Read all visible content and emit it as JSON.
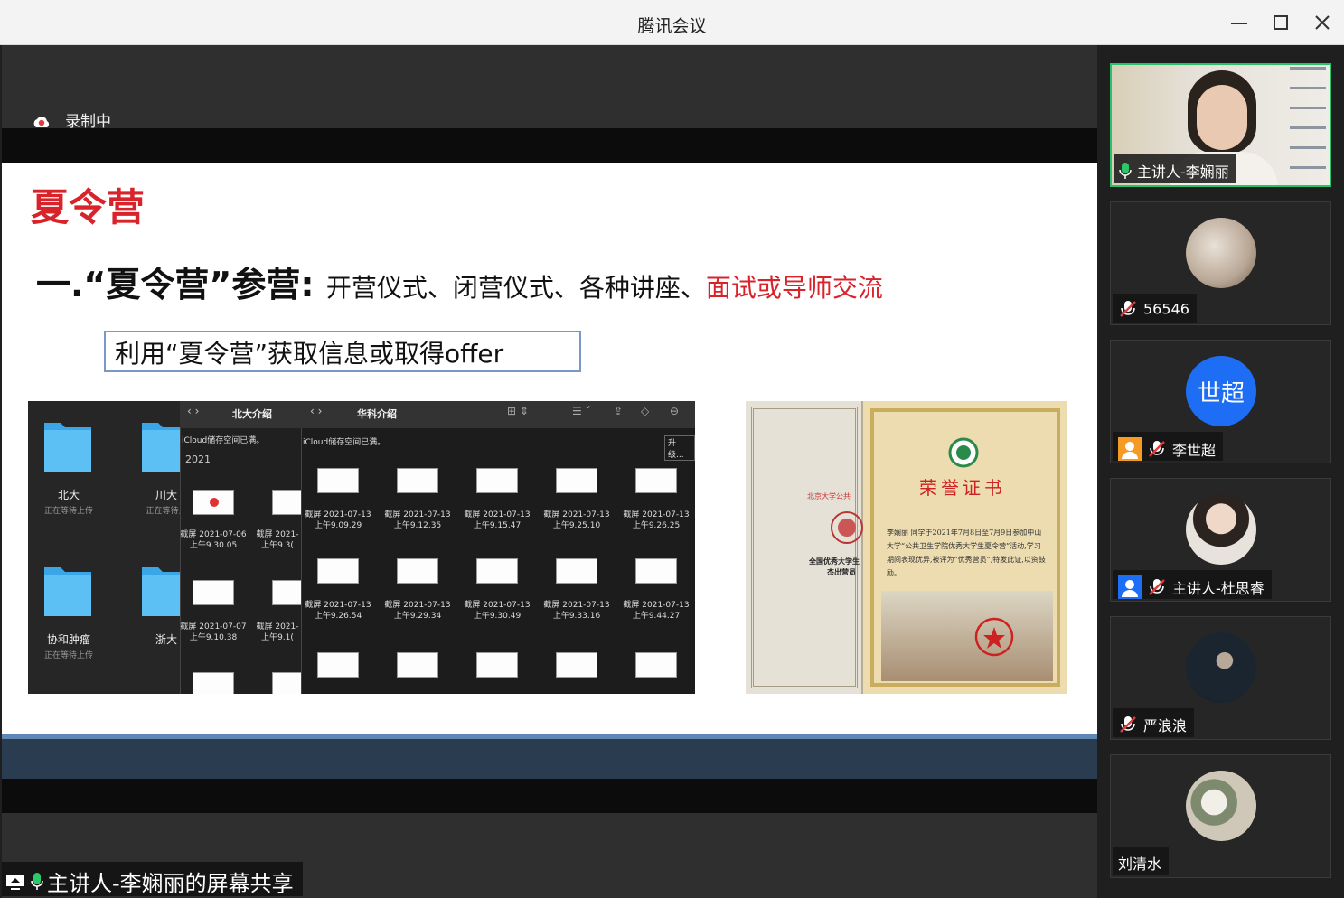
{
  "window": {
    "title": "腾讯会议"
  },
  "recording": {
    "label": "录制中"
  },
  "slide": {
    "heading": "夏令营",
    "line1_prefix": "一.“夏令营”参营:",
    "line1_items": "开营仪式、闭营仪式、各种讲座、",
    "line1_highlight": "面试或导师交流",
    "boxed_text": "利用“夏令营”获取信息或取得offer",
    "finder": {
      "left_tab": "北大介绍",
      "right_tab": "华科介绍",
      "icloud_left": "iCloud储存空间已满。",
      "icloud_right": "iCloud储存空间已满。",
      "upgrade": "升级...",
      "year": "2021",
      "folders": [
        {
          "name": "北大",
          "status": "正在等待上传"
        },
        {
          "name": "川大",
          "status": "正在等待上"
        },
        {
          "name": "协和肿瘤",
          "status": "正在等待上传"
        },
        {
          "name": "浙大",
          "status": ""
        }
      ],
      "mid_captions": [
        {
          "l1": "截屏 2021-07-06",
          "l2": "上午9.30.05"
        },
        {
          "l1": "截屏 2021-",
          "l2": "上午9.3("
        },
        {
          "l1": "截屏 2021-07-07",
          "l2": "上午9.10.38"
        },
        {
          "l1": "截屏 2021-",
          "l2": "上午9.1("
        }
      ],
      "right_captions": [
        {
          "l1": "截屏 2021-07-13",
          "l2": "上午9.09.29"
        },
        {
          "l1": "截屏 2021-07-13",
          "l2": "上午9.12.35"
        },
        {
          "l1": "截屏 2021-07-13",
          "l2": "上午9.15.47"
        },
        {
          "l1": "截屏 2021-07-13",
          "l2": "上午9.25.10"
        },
        {
          "l1": "截屏 2021-07-13",
          "l2": "上午9.26.25"
        },
        {
          "l1": "截屏 2021-07-13",
          "l2": "上午9.26.54"
        },
        {
          "l1": "截屏 2021-07-13",
          "l2": "上午9.29.34"
        },
        {
          "l1": "截屏 2021-07-13",
          "l2": "上午9.30.49"
        },
        {
          "l1": "截屏 2021-07-13",
          "l2": "上午9.33.16"
        },
        {
          "l1": "截屏 2021-07-13",
          "l2": "上午9.44.27"
        }
      ]
    },
    "certificate": {
      "title": "荣誉证书",
      "left_org": "北京大学公共",
      "left_award": "全国优秀大学生",
      "left_award2": "杰出营员",
      "body": "李娴丽 同学于2021年7月8日至7月9日参加中山大学“公共卫生学院优秀大学生夏令营”活动,学习期间表现优异,被评为“优秀营员”,特发此证,以资鼓励。"
    }
  },
  "share": {
    "label": "主讲人-李娴丽的屏幕共享"
  },
  "participants": [
    {
      "name": "主讲人-李娴丽",
      "mic": "on",
      "active": true
    },
    {
      "name": "56546",
      "mic": "muted"
    },
    {
      "name": "李世超",
      "mic": "muted",
      "avatar_text": "世超"
    },
    {
      "name": "主讲人-杜思睿",
      "mic": "muted"
    },
    {
      "name": "严浪浪",
      "mic": "muted"
    },
    {
      "name": "刘清水",
      "mic": "none"
    }
  ],
  "colors": {
    "accent_red": "#d9232b",
    "active_green": "#27c26a",
    "avatar_blue": "#1d6ef5"
  }
}
